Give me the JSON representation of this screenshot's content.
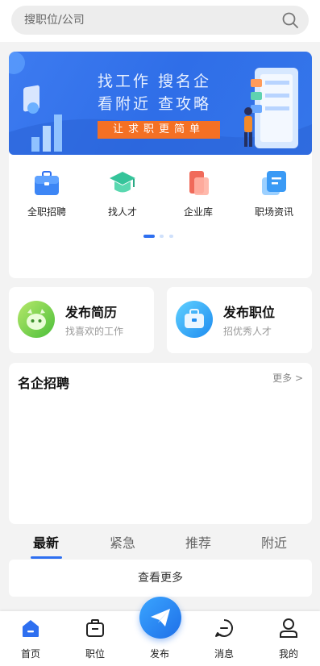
{
  "search": {
    "placeholder": "搜职位/公司"
  },
  "banner": {
    "line1": "找工作  搜名企",
    "line2": "看附近  查攻略",
    "cta": "让求职更简单"
  },
  "quick_links": [
    {
      "label": "全职招聘",
      "icon": "briefcase-icon"
    },
    {
      "label": "找人才",
      "icon": "graduation-cap-icon"
    },
    {
      "label": "企业库",
      "icon": "company-icon"
    },
    {
      "label": "职场资讯",
      "icon": "news-icon"
    }
  ],
  "carousel": {
    "pages": 3,
    "active": 0
  },
  "actions": [
    {
      "title": "发布简历",
      "subtitle": "找喜欢的工作",
      "icon": "resume-face-icon"
    },
    {
      "title": "发布职位",
      "subtitle": "招优秀人才",
      "icon": "bag-icon"
    }
  ],
  "companies": {
    "title": "名企招聘",
    "more": "更多 >"
  },
  "tabs": [
    {
      "label": "最新",
      "active": true
    },
    {
      "label": "紧急",
      "active": false
    },
    {
      "label": "推荐",
      "active": false
    },
    {
      "label": "附近",
      "active": false
    }
  ],
  "see_more": "查看更多",
  "nav": [
    {
      "label": "首页",
      "icon": "home-icon",
      "active": true
    },
    {
      "label": "职位",
      "icon": "job-bag-icon"
    },
    {
      "label": "发布",
      "icon": "paper-plane-icon"
    },
    {
      "label": "消息",
      "icon": "message-icon"
    },
    {
      "label": "我的",
      "icon": "user-icon"
    }
  ],
  "colors": {
    "accent": "#2e6ff0",
    "cta_orange": "#f47024",
    "page_bg": "#f3f3f3"
  }
}
